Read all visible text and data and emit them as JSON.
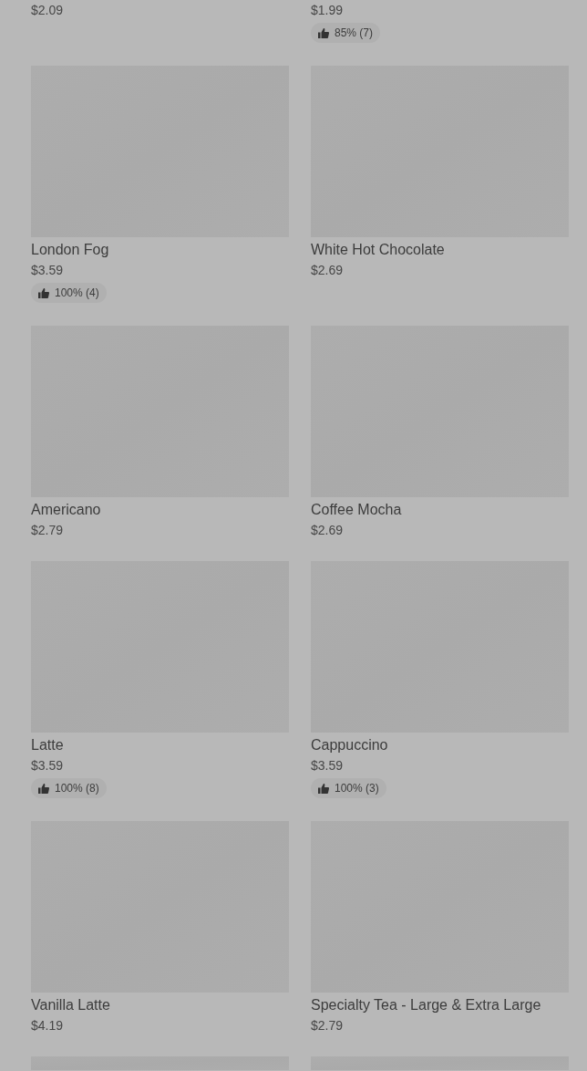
{
  "items": [
    {
      "price": "$2.09"
    },
    {
      "price": "$1.99",
      "rating": "85% (7)"
    },
    {
      "name": "London Fog",
      "price": "$3.59",
      "rating": "100% (4)"
    },
    {
      "name": "White Hot Chocolate",
      "price": "$2.69"
    },
    {
      "name": "Americano",
      "price": "$2.79"
    },
    {
      "name": "Coffee Mocha",
      "price": "$2.69"
    },
    {
      "name": "Latte",
      "price": "$3.59",
      "rating": "100% (8)"
    },
    {
      "name": "Cappuccino",
      "price": "$3.59",
      "rating": "100% (3)"
    },
    {
      "name": "Vanilla Latte",
      "price": "$4.19"
    },
    {
      "name": "Specialty Tea - Large & Extra Large",
      "price": "$2.79"
    },
    {
      "kind": "placeholder"
    },
    {
      "kind": "placeholder"
    }
  ]
}
